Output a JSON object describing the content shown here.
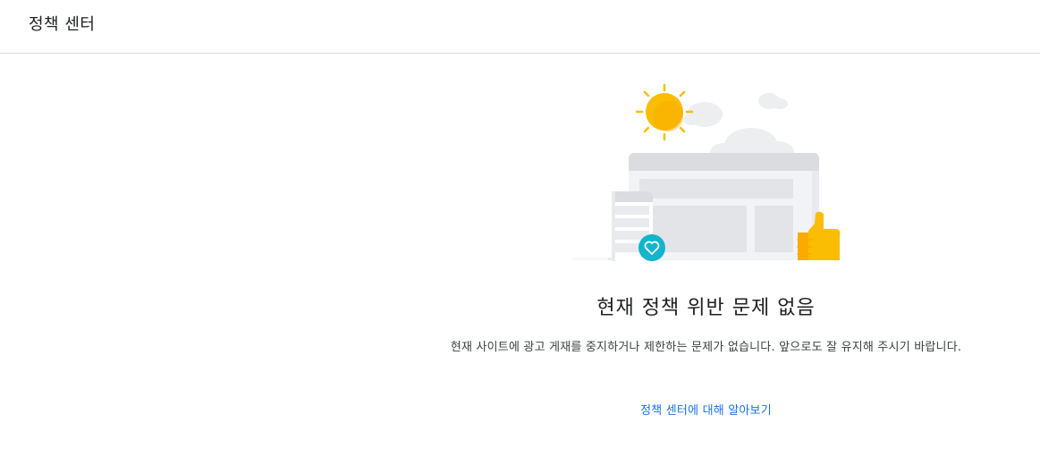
{
  "header": {
    "title": "정책 센터"
  },
  "status": {
    "heading": "현재 정책 위반 문제 없음",
    "description": "현재 사이트에 광고 게재를 중지하거나 제한하는 문제가 없습니다. 앞으로도 잘 유지해 주시기 바랍니다.",
    "link_label": "정책 센터에 대해 알아보기"
  },
  "illustration": {
    "icons": [
      "sun-icon",
      "cloud-icon",
      "browser-window-icon",
      "mobile-device-icon",
      "heart-icon",
      "thumbs-up-icon"
    ],
    "colors": {
      "sun": "#fbbc04",
      "teal": "#12b5cb",
      "window_gray": "#dadce0",
      "window_light": "#f1f3f4"
    }
  },
  "colors": {
    "link": "#1a73e8",
    "divider": "#dadce0",
    "text": "#202124"
  }
}
